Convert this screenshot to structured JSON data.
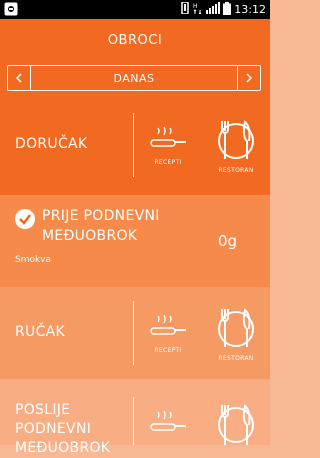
{
  "status_bar": {
    "time": "13:12",
    "icons": [
      "android-debug-icon",
      "vibrate-icon",
      "data-icon",
      "signal-icon",
      "battery-icon"
    ]
  },
  "header": {
    "title": "OBROCI"
  },
  "date_nav": {
    "label": "DANAS",
    "prev_icon": "chevron-left-icon",
    "next_icon": "chevron-right-icon"
  },
  "meals": [
    {
      "name": "DORUČAK",
      "recept_label": "RECEPTI",
      "restoran_label": "RESTORAN"
    },
    {
      "name_line1": "PRIJE PODNEVNI",
      "name_line2": "MEĐUOBROK",
      "amount": "0g",
      "food": "Smokva"
    },
    {
      "name": "RUČAK",
      "recept_label": "RECEPTI",
      "restoran_label": "RESTORAN"
    },
    {
      "name_line1": "POSLIJE",
      "name_line2": "PODNEVNI",
      "name_line3": "MEĐUOBROK"
    }
  ],
  "colors": {
    "primary": "#f26a21",
    "row2": "#f58a4b",
    "row3": "#f59a63",
    "row4": "#f8ad82"
  }
}
